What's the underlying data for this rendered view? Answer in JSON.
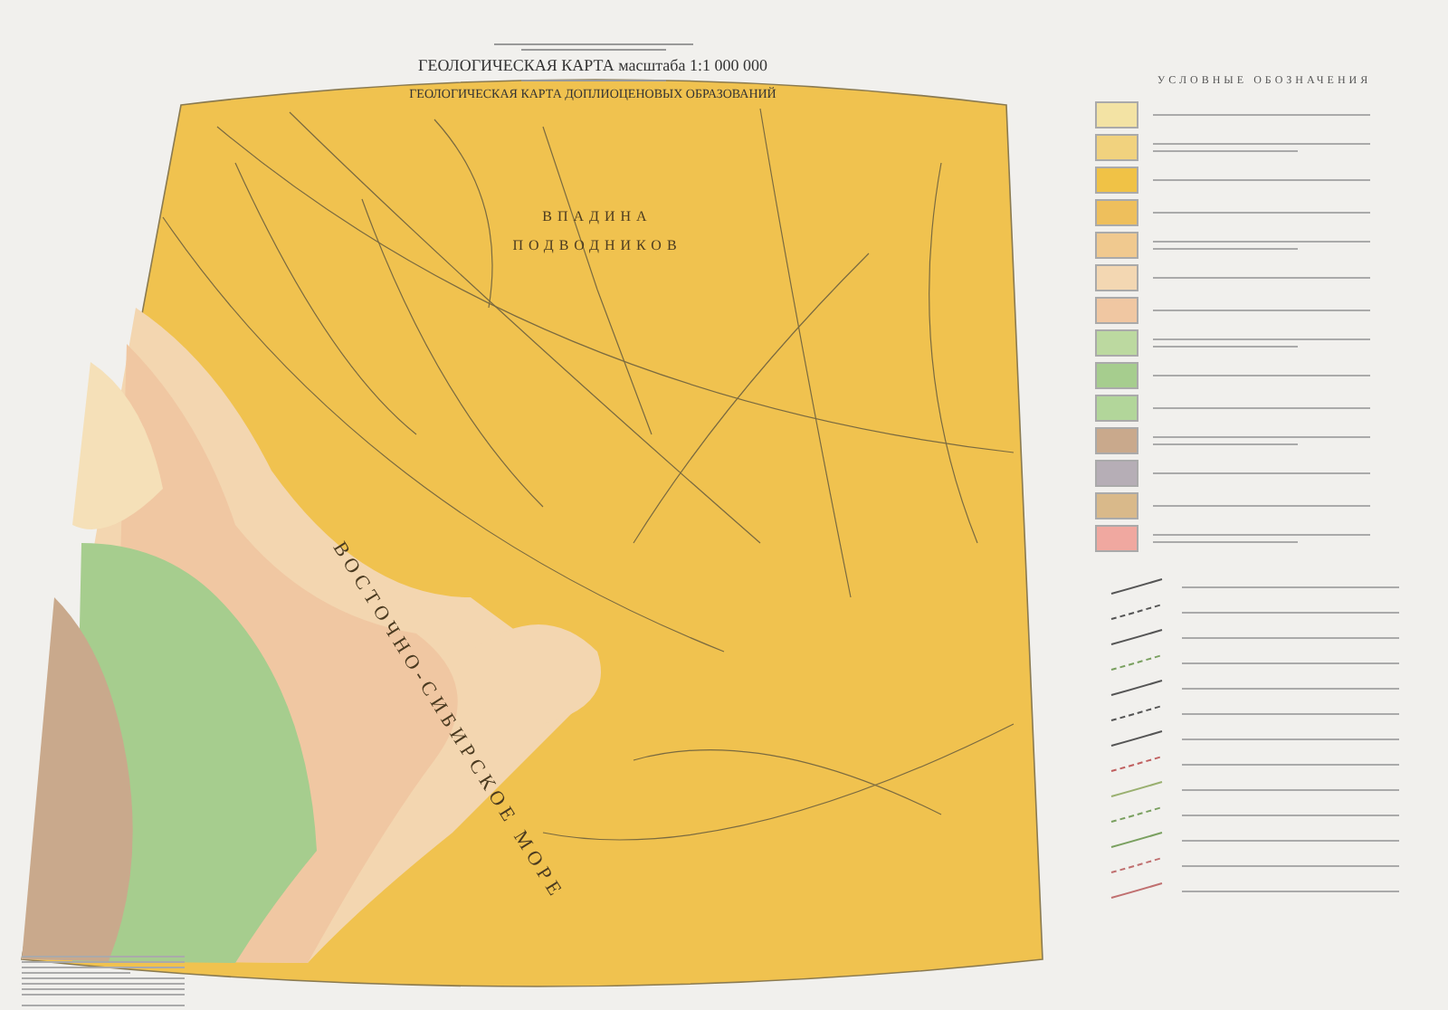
{
  "header": {
    "title": "ГЕОЛОГИЧЕСКАЯ КАРТА масштаба 1:1 000 000",
    "subtitle": "ГЕОЛОГИЧЕСКАЯ КАРТА ДОПЛИОЦЕНОВЫХ ОБРАЗОВАНИЙ"
  },
  "map": {
    "labels": [
      {
        "kind": "feature",
        "text": "ВПАДИНА"
      },
      {
        "kind": "feature",
        "text": "ПОДВОДНИКОВ"
      },
      {
        "kind": "sea",
        "text": "ВОСТОЧНО-СИБИРСКОЕ МОРЕ"
      }
    ]
  },
  "legend": {
    "title": "УСЛОВНЫЕ ОБОЗНАЧЕНИЯ",
    "units": [
      {
        "color": "#f3e3a4"
      },
      {
        "color": "#f1d27e"
      },
      {
        "color": "#f0c246"
      },
      {
        "color": "#eebf5c"
      },
      {
        "color": "#f0c98f"
      },
      {
        "color": "#f3d7b2"
      },
      {
        "color": "#f0c7a2"
      },
      {
        "color": "#bcd9a0"
      },
      {
        "color": "#a6cd8e"
      },
      {
        "color": "#b2d69a"
      },
      {
        "color": "#c9a98c"
      },
      {
        "color": "#b6aeb6"
      },
      {
        "color": "#d9b98a"
      },
      {
        "color": "#f0a8a0"
      }
    ],
    "symbols": [
      {
        "color": "#555555"
      },
      {
        "color": "#555555"
      },
      {
        "color": "#555555"
      },
      {
        "color": "#7aa060"
      },
      {
        "color": "#555555"
      },
      {
        "color": "#555555"
      },
      {
        "color": "#555555"
      },
      {
        "color": "#c06060"
      },
      {
        "color": "#9ab070"
      },
      {
        "color": "#7aa060"
      },
      {
        "color": "#7aa060"
      },
      {
        "color": "#c07070"
      },
      {
        "color": "#c07070"
      }
    ]
  }
}
